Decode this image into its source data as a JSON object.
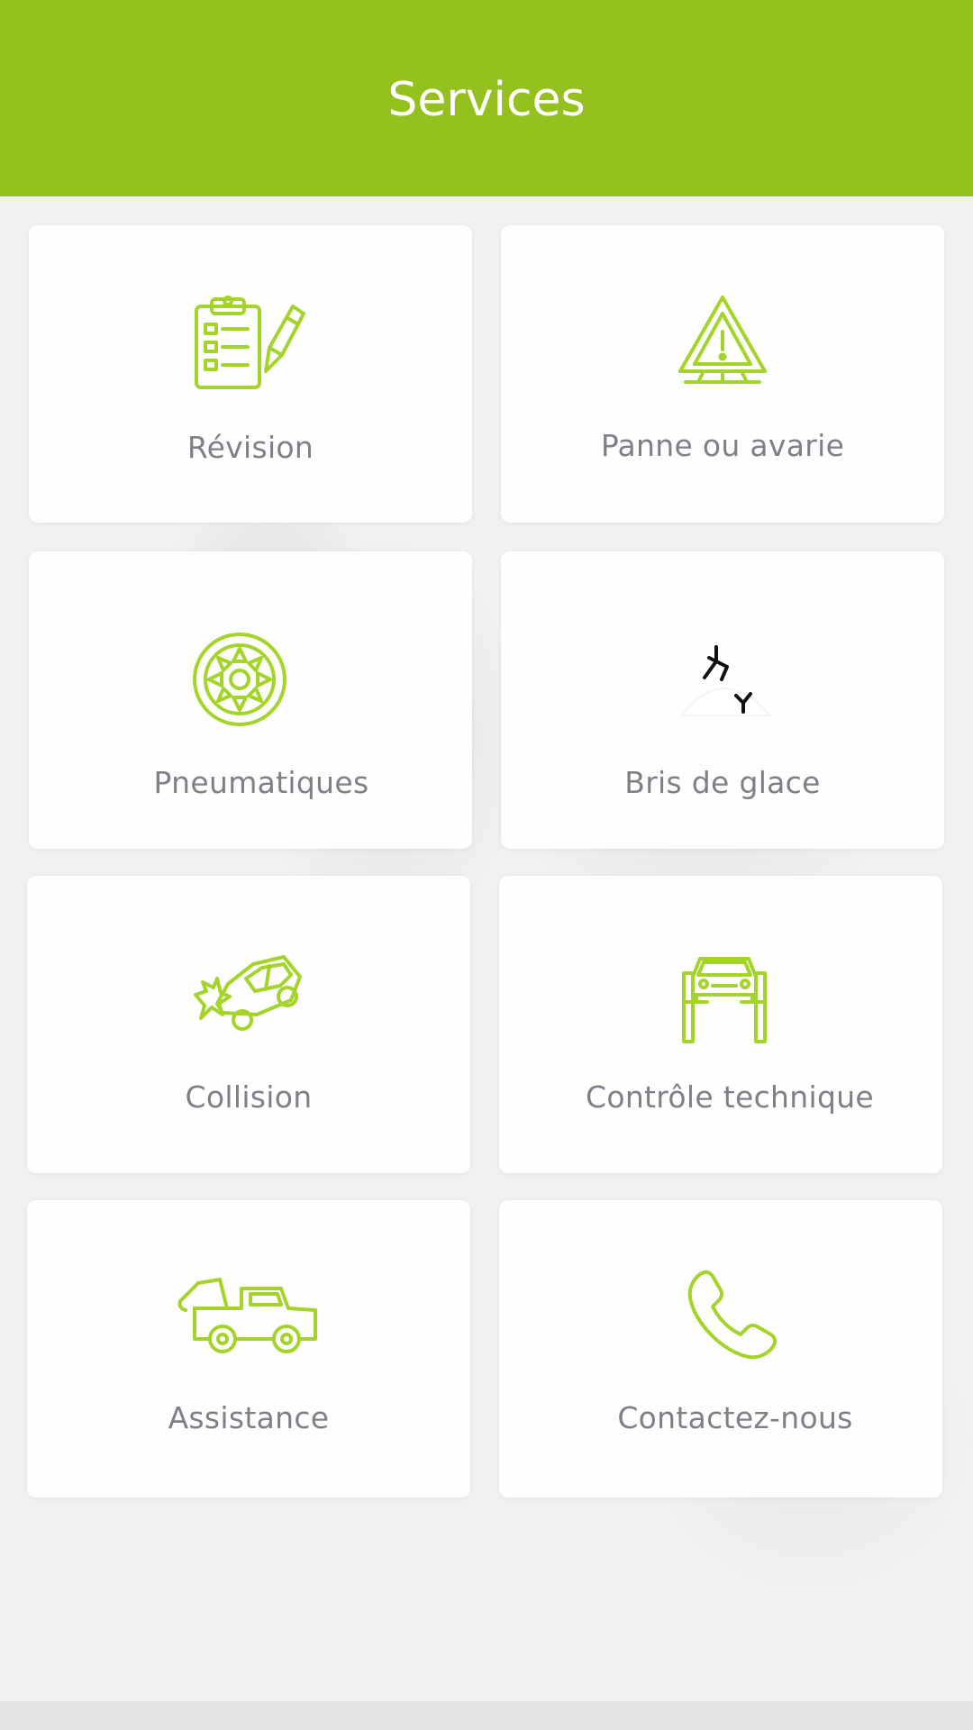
{
  "header": {
    "title": "Services",
    "background_color": "#95c11f"
  },
  "accent_color": "#a4d42a",
  "label_color": "#807f88",
  "services": [
    {
      "label": "Révision",
      "icon": "clipboard-checklist-icon"
    },
    {
      "label": "Panne ou avarie",
      "icon": "warning-triangle-icon"
    },
    {
      "label": "Pneumatiques",
      "icon": "tire-wheel-icon"
    },
    {
      "label": "Bris de glace",
      "icon": "broken-glass-icon"
    },
    {
      "label": "Collision",
      "icon": "car-crash-icon"
    },
    {
      "label": "Contrôle technique",
      "icon": "car-lift-icon"
    },
    {
      "label": "Assistance",
      "icon": "tow-truck-icon"
    },
    {
      "label": "Contactez-nous",
      "icon": "phone-icon"
    }
  ]
}
